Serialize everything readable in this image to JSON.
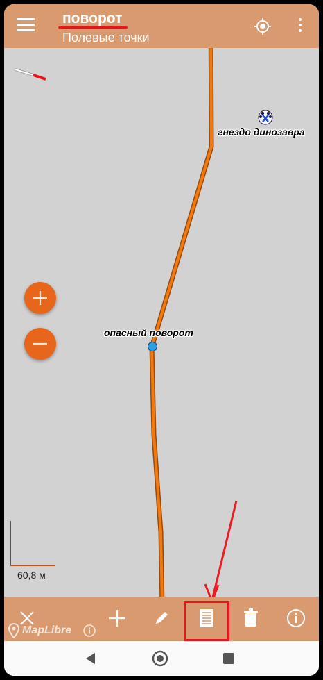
{
  "app_bar": {
    "title": "поворот",
    "subtitle": "Полевые точки",
    "menu_icon": "hamburger-menu-icon",
    "locate_icon": "gps-locate-icon",
    "more_icon": "more-vertical-icon"
  },
  "map": {
    "points": [
      {
        "label": "гнездо динозавра",
        "icon": "paw-marker-icon"
      },
      {
        "label": "опасный поворот",
        "icon": "blue-dot-marker"
      }
    ],
    "track_color": "#f07a10",
    "scale_label": "60,8 м",
    "attribution": "MapLibre"
  },
  "zoom": {
    "in_icon": "plus-icon",
    "out_icon": "minus-icon",
    "button_color": "#e8661c"
  },
  "toolbar": {
    "buttons": [
      {
        "name": "close",
        "icon": "close-icon"
      },
      {
        "name": "add",
        "icon": "plus-icon"
      },
      {
        "name": "edit",
        "icon": "pencil-icon"
      },
      {
        "name": "notes",
        "icon": "document-icon"
      },
      {
        "name": "delete",
        "icon": "trash-icon"
      },
      {
        "name": "info",
        "icon": "info-icon"
      }
    ],
    "bar_color": "#d99a6f",
    "highlight_color": "#e8131b"
  },
  "system_nav": {
    "back_icon": "back-triangle-icon",
    "home_icon": "home-circle-icon",
    "recents_icon": "recents-square-icon"
  }
}
